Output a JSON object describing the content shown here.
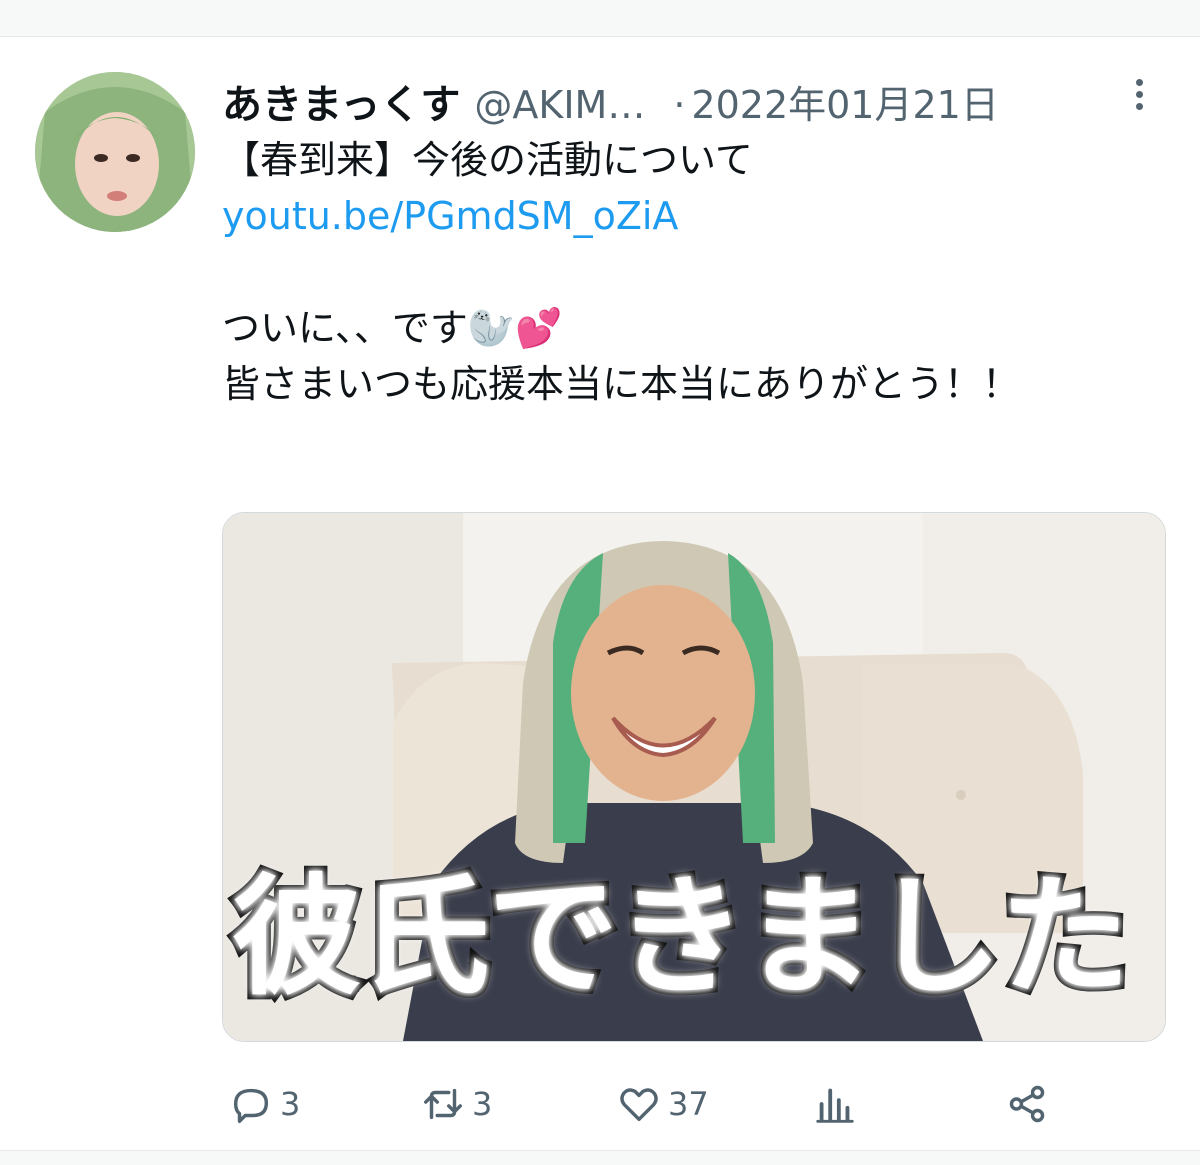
{
  "tweet": {
    "display_name": "あきまっくす",
    "handle": "@AKIM…",
    "separator": "·",
    "date": "2022年01月21日",
    "lines": [
      "【春到来】今後の活動について",
      "youtu.be/PGmdSM_oZiA",
      "ついに、、です🦭💕",
      "皆さまいつも応援本当に本当にありがとう！！"
    ]
  },
  "media": {
    "caption": "彼氏できました"
  },
  "actions": {
    "reply_count": "3",
    "retweet_count": "3",
    "like_count": "37"
  },
  "colors": {
    "link": "#1d9bf0",
    "muted": "#536471",
    "text": "#0f1419"
  }
}
